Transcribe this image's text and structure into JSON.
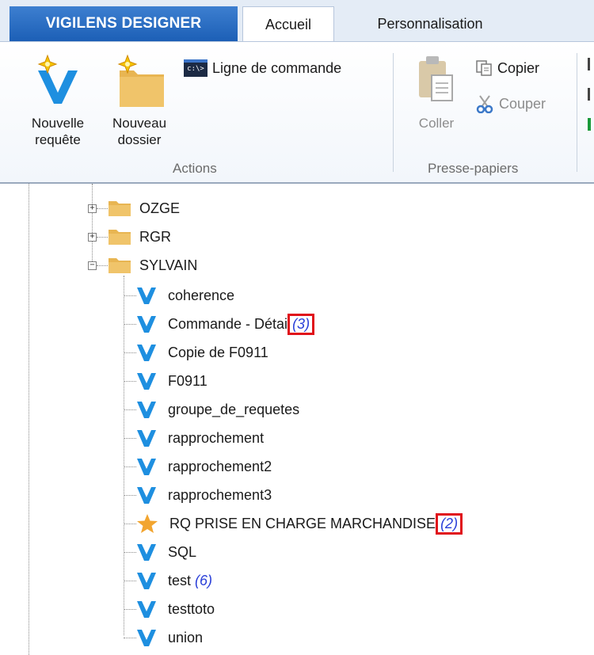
{
  "app": {
    "tab_title": "VIGILENS DESIGNER"
  },
  "tabs": [
    {
      "label": "Accueil",
      "active": true
    },
    {
      "label": "Personnalisation",
      "active": false
    }
  ],
  "ribbon": {
    "actions": {
      "label": "Actions",
      "new_query_line1": "Nouvelle",
      "new_query_line2": "requête",
      "new_folder_line1": "Nouveau",
      "new_folder_line2": "dossier",
      "command_line": "Ligne de commande",
      "cmd_icon_text": "c:\\>"
    },
    "clipboard": {
      "label": "Presse-papiers",
      "paste": "Coller",
      "copy": "Copier",
      "cut": "Couper"
    }
  },
  "tree": {
    "folders": [
      {
        "name": "OZGE",
        "expanded": false
      },
      {
        "name": "RGR",
        "expanded": false
      },
      {
        "name": "SYLVAIN",
        "expanded": true
      }
    ],
    "items": [
      {
        "name": "coherence",
        "icon": "query-icon",
        "count": null
      },
      {
        "name": "Commande - Détai",
        "icon": "query-icon",
        "count": "(3)",
        "highlighted": true
      },
      {
        "name": "Copie de F0911",
        "icon": "query-icon",
        "count": null
      },
      {
        "name": "F0911",
        "icon": "query-icon",
        "count": null
      },
      {
        "name": "groupe_de_requetes",
        "icon": "query-icon",
        "count": null
      },
      {
        "name": "rapprochement",
        "icon": "query-icon",
        "count": null
      },
      {
        "name": "rapprochement2",
        "icon": "query-icon",
        "count": null
      },
      {
        "name": "rapprochement3",
        "icon": "query-icon",
        "count": null
      },
      {
        "name": "RQ PRISE EN CHARGE MARCHANDISE",
        "icon": "star-icon",
        "count": "(2)",
        "highlighted": true
      },
      {
        "name": "SQL",
        "icon": "query-icon",
        "count": null
      },
      {
        "name": "test",
        "icon": "query-icon",
        "count": "(6)"
      },
      {
        "name": "testtoto",
        "icon": "query-icon",
        "count": null
      },
      {
        "name": "union",
        "icon": "query-icon",
        "count": null
      }
    ]
  },
  "colors": {
    "brand_tab": "#1c5fb6",
    "query_icon": "#1e8fe0",
    "folder": "#e8b552",
    "highlight_box": "#e0101a",
    "count_text": "#2a3fd8",
    "star": "#f2a530"
  }
}
